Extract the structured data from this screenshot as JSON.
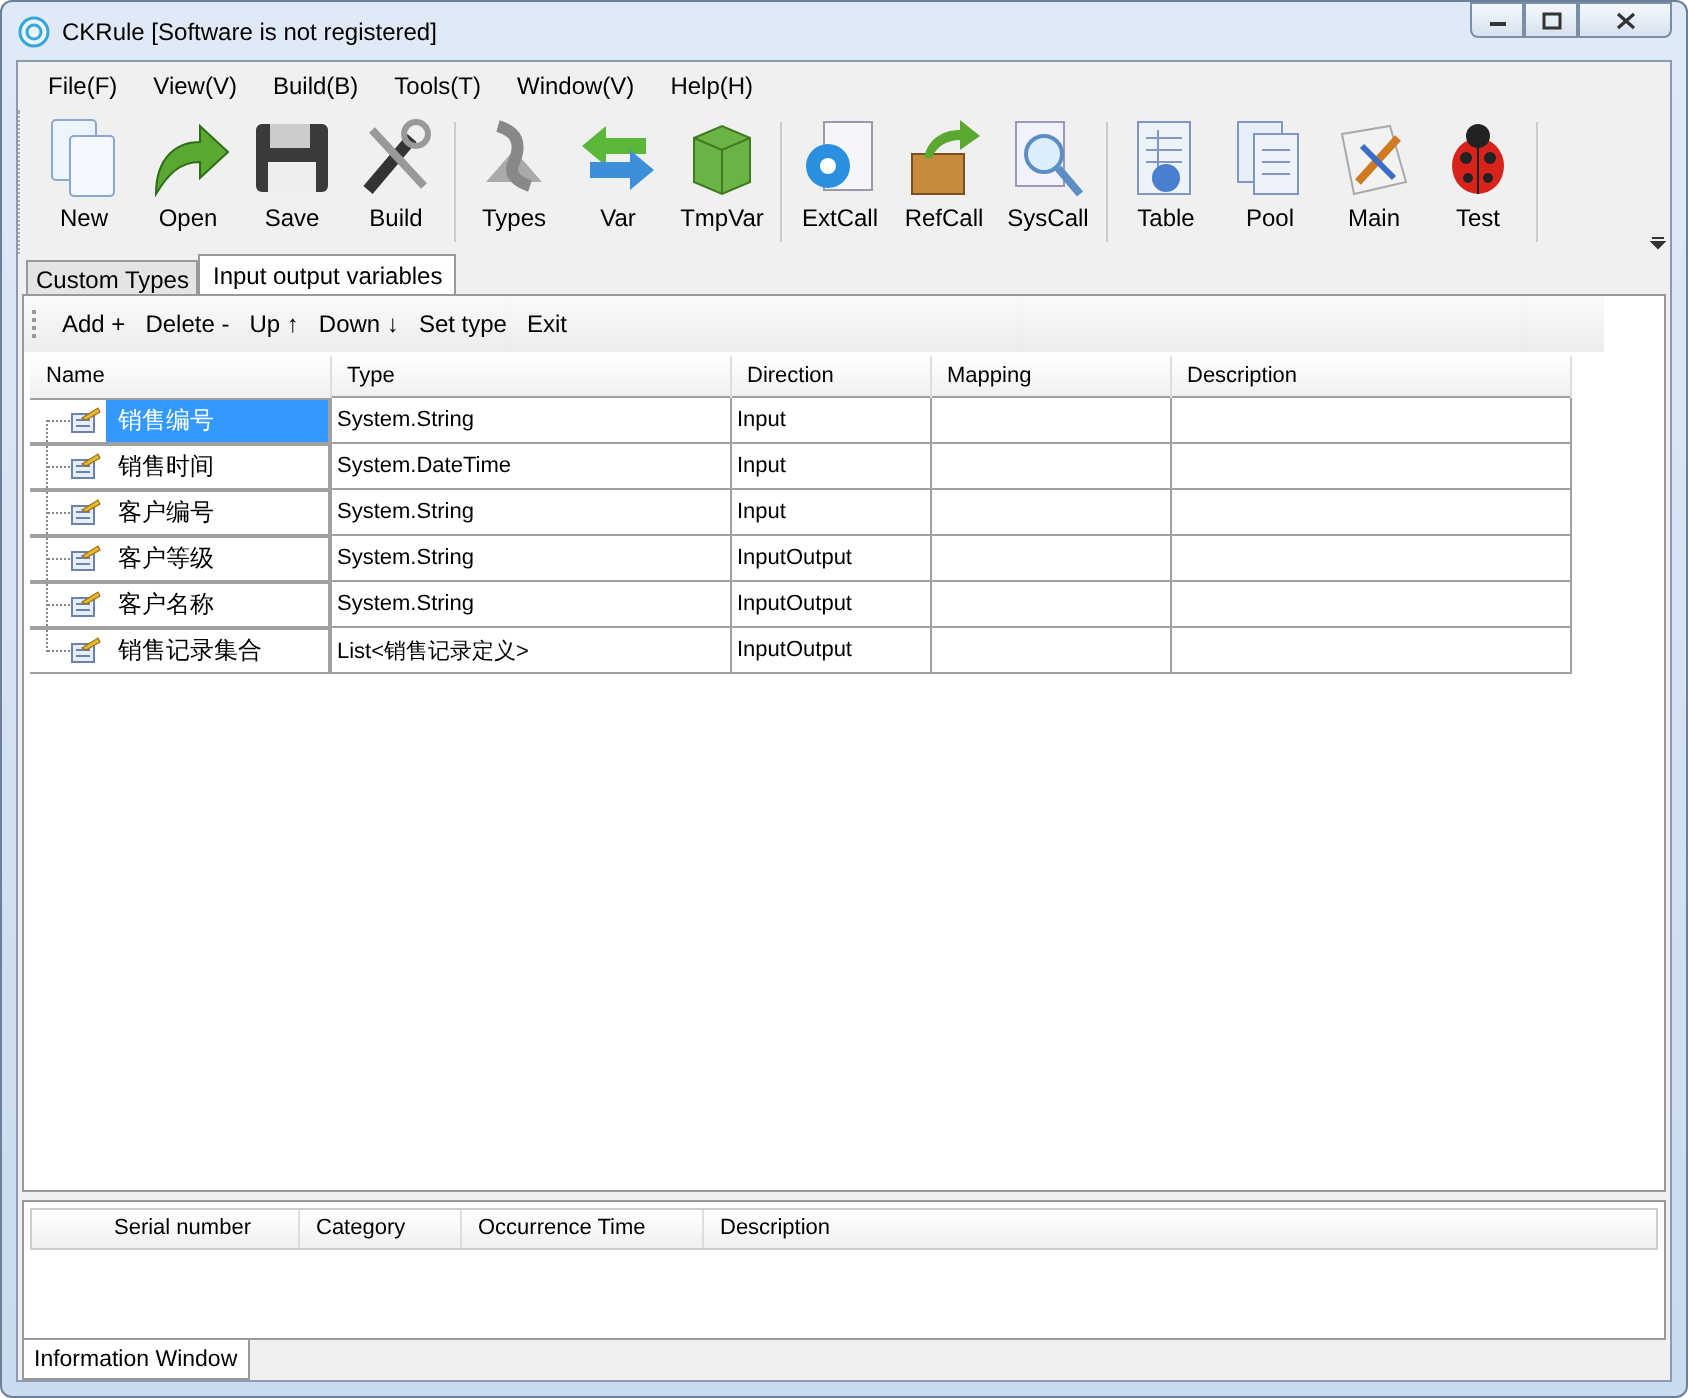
{
  "window": {
    "title": "CKRule [Software is not registered]"
  },
  "menu": [
    "File(F)",
    "View(V)",
    "Build(B)",
    "Tools(T)",
    "Window(V)",
    "Help(H)"
  ],
  "toolbar_groups": [
    [
      "New",
      "Open",
      "Save",
      "Build"
    ],
    [
      "Types",
      "Var",
      "TmpVar"
    ],
    [
      "ExtCall",
      "RefCall",
      "SysCall"
    ],
    [
      "Table",
      "Pool",
      "Main",
      "Test"
    ]
  ],
  "tabs": [
    {
      "label": "Custom Types",
      "selected": false
    },
    {
      "label": "Input output variables",
      "selected": true
    }
  ],
  "grid_toolbar": [
    "Add +",
    "Delete -",
    "Up ↑",
    "Down ↓",
    "Set type",
    "Exit"
  ],
  "table": {
    "columns": [
      "Name",
      "Type",
      "Direction",
      "Mapping",
      "Description"
    ],
    "rows": [
      {
        "name": "销售编号",
        "type": "System.String",
        "direction": "Input",
        "selected": true
      },
      {
        "name": "销售时间",
        "type": "System.DateTime",
        "direction": "Input",
        "selected": false
      },
      {
        "name": "客户编号",
        "type": "System.String",
        "direction": "Input",
        "selected": false
      },
      {
        "name": "客户等级",
        "type": "System.String",
        "direction": "InputOutput",
        "selected": false
      },
      {
        "name": "客户名称",
        "type": "System.String",
        "direction": "InputOutput",
        "selected": false
      },
      {
        "name": "销售记录集合",
        "type": "List<销售记录定义>",
        "direction": "InputOutput",
        "selected": false
      }
    ]
  },
  "info_table": {
    "columns": [
      "Serial number",
      "Category",
      "Occurrence Time",
      "Description"
    ]
  },
  "bottom_tabs": [
    {
      "label": "Information Window",
      "selected": true
    }
  ]
}
